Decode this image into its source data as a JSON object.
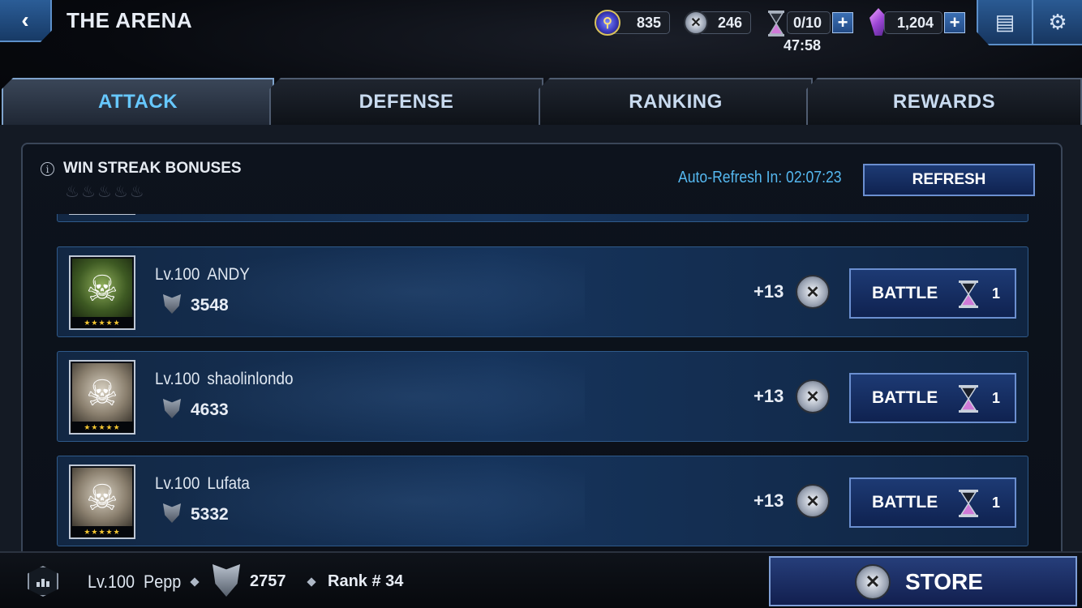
{
  "header": {
    "back_icon": "chevron-left-icon",
    "title": "THE ARENA",
    "iso8": "835",
    "arena_coins": "246",
    "energy": "0/10",
    "energy_timer": "47:58",
    "crystals": "1,204"
  },
  "tabs": [
    {
      "label": "ATTACK",
      "active": true
    },
    {
      "label": "DEFENSE",
      "active": false
    },
    {
      "label": "RANKING",
      "active": false
    },
    {
      "label": "REWARDS",
      "active": false
    }
  ],
  "streak": {
    "title": "WIN STREAK BONUSES",
    "refresh_label": "Auto-Refresh In: 02:07:23",
    "refresh_button": "REFRESH"
  },
  "opponents": [
    {
      "level": "Lv.100",
      "name": "ANDY",
      "power": "3548",
      "reward": "+13",
      "battle_label": "BATTLE",
      "cost": "1",
      "avatar_icon": "skull-face-icon"
    },
    {
      "level": "Lv.100",
      "name": "shaolinlondo",
      "power": "4633",
      "reward": "+13",
      "battle_label": "BATTLE",
      "cost": "1",
      "avatar_icon": "mummy-face-icon"
    },
    {
      "level": "Lv.100",
      "name": "Lufata",
      "power": "5332",
      "reward": "+13",
      "battle_label": "BATTLE",
      "cost": "1",
      "avatar_icon": "mummy-face-icon"
    }
  ],
  "footer": {
    "level": "Lv.100",
    "name": "Pepp",
    "power": "2757",
    "rank": "Rank # 34",
    "store_label": "STORE"
  },
  "colors": {
    "accent_tab": "#67c8ff",
    "refresh_text": "#55b8f0",
    "button_fill": "#1d3a74",
    "star": "#f2c531"
  }
}
